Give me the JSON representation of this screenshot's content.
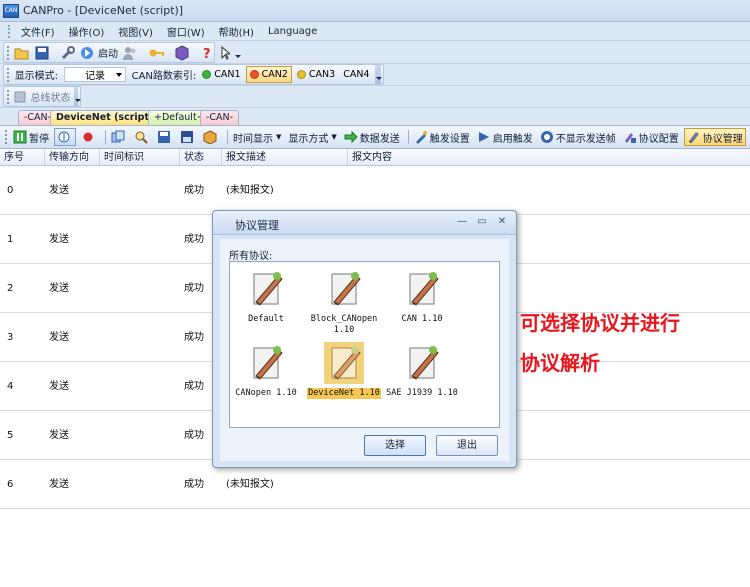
{
  "window": {
    "title": "CANPro - [DeviceNet (script)]",
    "app_icon_text": "CAN"
  },
  "menu": {
    "items": [
      "文件(F)",
      "操作(O)",
      "视图(V)",
      "窗口(W)",
      "帮助(H)",
      "Language"
    ]
  },
  "main_toolbar": {
    "start_label": "启动"
  },
  "display_toolbar": {
    "mode_label": "显示模式:",
    "mode_value": "记录",
    "can_index_label": "CAN路数索引:",
    "channels": [
      {
        "label": "CAN1",
        "color": "#3cb43c"
      },
      {
        "label": "CAN2",
        "color": "#e8532b"
      },
      {
        "label": "CAN3",
        "color": "#e8c02b"
      },
      {
        "label": "CAN4",
        "color": ""
      }
    ]
  },
  "status_toolbar": {
    "bus_status_label": "总线状态"
  },
  "tabs": [
    {
      "label": "-CAN-"
    },
    {
      "label": "DeviceNet (script)"
    },
    {
      "label": "+Default+"
    },
    {
      "label": "-CAN-"
    }
  ],
  "function_toolbar": {
    "pause": "暂停",
    "time_display": "时间显示",
    "display_mode": "显示方式",
    "send_data": "数据发送",
    "trigger_settings": "触发设置",
    "enable_trigger": "启用触发",
    "hide_send_frames": "不显示发送帧",
    "protocol_config": "协议配置",
    "protocol_manage": "协议管理"
  },
  "table": {
    "headers": [
      "序号",
      "传输方向",
      "时间标识",
      "状态",
      "报文描述",
      "报文内容"
    ],
    "rows": [
      {
        "seq": "0",
        "dir": "发送",
        "status": "成功",
        "desc": "(未知报文)"
      },
      {
        "seq": "1",
        "dir": "发送",
        "status": "成功",
        "desc": ""
      },
      {
        "seq": "2",
        "dir": "发送",
        "status": "成功",
        "desc": ""
      },
      {
        "seq": "3",
        "dir": "发送",
        "status": "成功",
        "desc": ""
      },
      {
        "seq": "4",
        "dir": "发送",
        "status": "成功",
        "desc": ""
      },
      {
        "seq": "5",
        "dir": "发送",
        "status": "成功",
        "desc": ""
      },
      {
        "seq": "6",
        "dir": "发送",
        "status": "成功",
        "desc": "(未知报文)"
      }
    ]
  },
  "dialog": {
    "title": "协议管理",
    "all_protocols_label": "所有协议:",
    "protocols": [
      {
        "label": "Default"
      },
      {
        "label": "Block_CANopen\n1.10"
      },
      {
        "label": "CAN 1.10"
      },
      {
        "label": "CANopen 1.10"
      },
      {
        "label": "DeviceNet 1.10"
      },
      {
        "label": "SAE J1939 1.10"
      }
    ],
    "selected_protocol": "DeviceNet 1.10",
    "select_button": "选择",
    "exit_button": "退出"
  },
  "annotation": {
    "line1": "可选择协议并进行",
    "line2": "协议解析",
    "color": "#e8161d"
  }
}
